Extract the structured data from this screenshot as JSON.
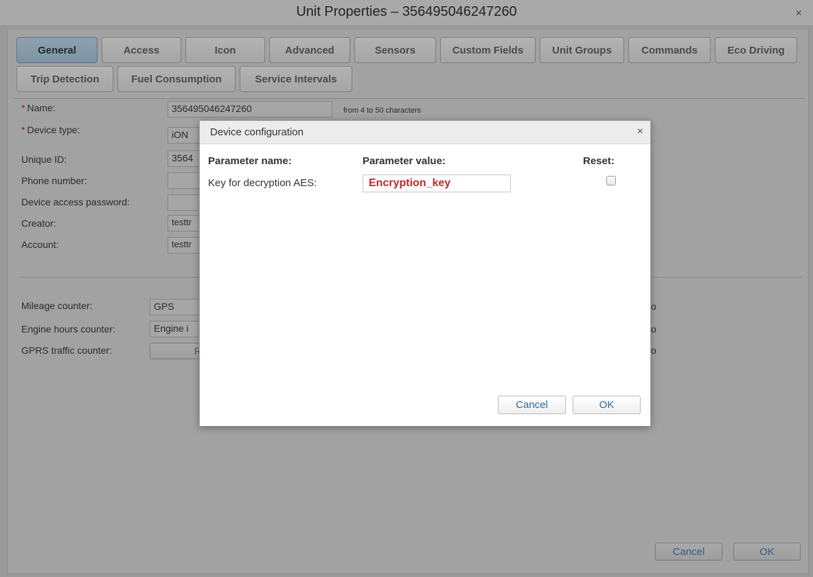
{
  "window": {
    "title": "Unit Properties – 356495046247260",
    "close_glyph": "×"
  },
  "tabs": [
    {
      "label": "General",
      "active": true
    },
    {
      "label": "Access"
    },
    {
      "label": "Icon"
    },
    {
      "label": "Advanced"
    },
    {
      "label": "Sensors"
    },
    {
      "label": "Custom Fields"
    },
    {
      "label": "Unit Groups"
    },
    {
      "label": "Commands"
    },
    {
      "label": "Eco Driving"
    },
    {
      "label": "Trip Detection"
    },
    {
      "label": "Fuel Consumption"
    },
    {
      "label": "Service Intervals"
    }
  ],
  "form": {
    "required_mark": "*",
    "name": {
      "label": "Name:",
      "value": "356495046247260",
      "hint": "from 4 to 50 characters"
    },
    "device_type": {
      "label": "Device type:",
      "value": "iON"
    },
    "unique_id": {
      "label": "Unique ID:",
      "value": "3564"
    },
    "phone": {
      "label": "Phone number:",
      "value": ""
    },
    "password": {
      "label": "Device access password:",
      "value": ""
    },
    "creator": {
      "label": "Creator:",
      "value": "testtr"
    },
    "account": {
      "label": "Account:",
      "value": "testtr"
    }
  },
  "counters": {
    "mileage": {
      "label": "Mileage counter:",
      "value": "GPS"
    },
    "engine_hours": {
      "label": "Engine hours counter:",
      "value": "Engine i"
    },
    "gprs": {
      "label": "GPRS traffic counter:",
      "button": "R"
    },
    "right_fragment": "o"
  },
  "footer": {
    "cancel": "Cancel",
    "ok": "OK"
  },
  "modal": {
    "title": "Device configuration",
    "close_glyph": "×",
    "columns": {
      "name": "Parameter name:",
      "value": "Parameter value:",
      "reset": "Reset:"
    },
    "param": {
      "name": "Key for decryption AES:",
      "value": "Encryption_key",
      "reset_checked": false
    },
    "cancel": "Cancel",
    "ok": "OK"
  },
  "colors": {
    "active_tab": "#8fa1b0",
    "param_value": "#c0282a",
    "button_text": "#2f6a9b"
  }
}
